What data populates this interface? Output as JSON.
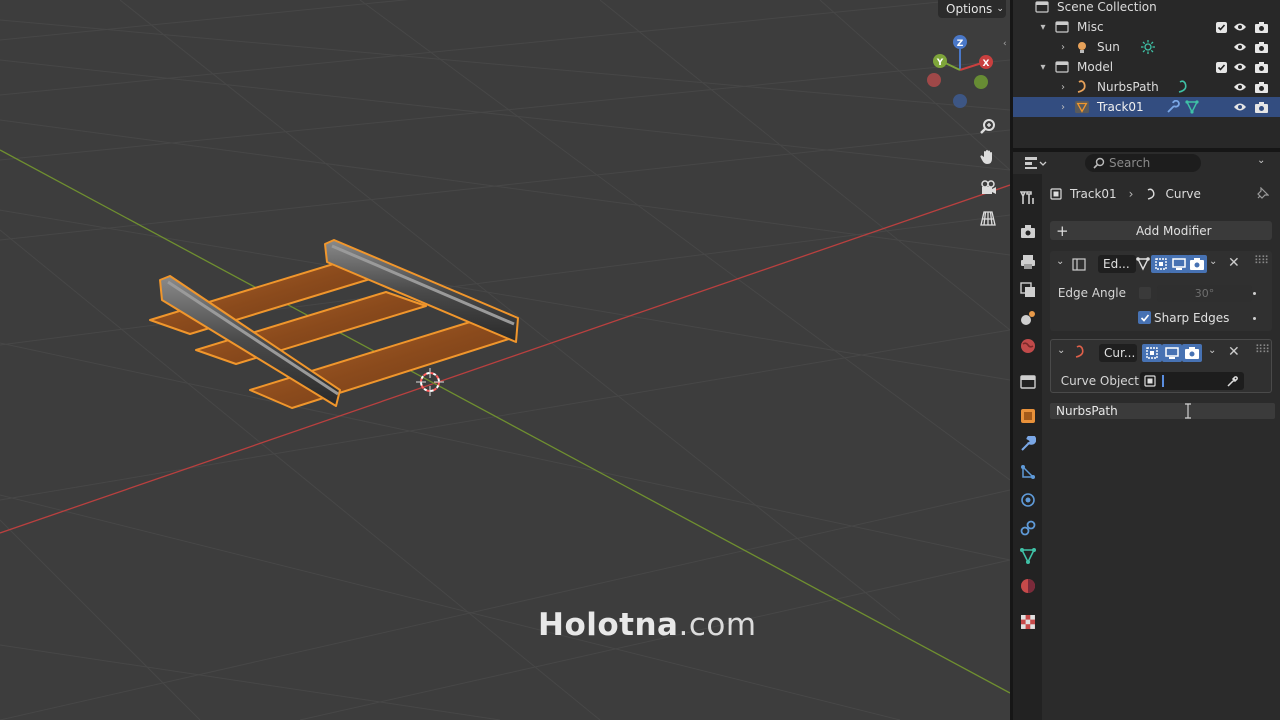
{
  "viewport": {
    "options_label": "Options",
    "watermark_bold": "Holotna",
    "watermark_light": ".com",
    "gizmo": {
      "x_label": "X",
      "y_label": "Y",
      "z_label": "Z"
    }
  },
  "outliner": {
    "rows": [
      {
        "label": "Scene Collection",
        "type": "scene-collection"
      },
      {
        "label": "Misc",
        "type": "collection"
      },
      {
        "label": "Sun",
        "type": "light"
      },
      {
        "label": "Model",
        "type": "collection"
      },
      {
        "label": "NurbsPath",
        "type": "curve"
      },
      {
        "label": "Track01",
        "type": "mesh",
        "selected": true
      }
    ]
  },
  "properties": {
    "search_placeholder": "Search",
    "breadcrumb": {
      "object": "Track01",
      "modifier": "Curve"
    },
    "add_modifier_label": "Add Modifier",
    "edge_split": {
      "name": "Ed...",
      "edge_angle_label": "Edge Angle",
      "edge_angle_value": "30°",
      "edge_angle_enabled": false,
      "sharp_edges_label": "Sharp Edges",
      "sharp_edges_checked": true
    },
    "curve_modifier": {
      "name": "Cur...",
      "curve_object_label": "Curve Object",
      "curve_object_value": ""
    },
    "dropdown": {
      "items": [
        "NurbsPath"
      ]
    }
  },
  "colors": {
    "selection": "#334d80",
    "accent": "#4772b3",
    "viewport_bg": "#3d3d3d",
    "x_axis": "#c9403f",
    "y_axis": "#7ea53a",
    "outline": "#f0962c"
  }
}
